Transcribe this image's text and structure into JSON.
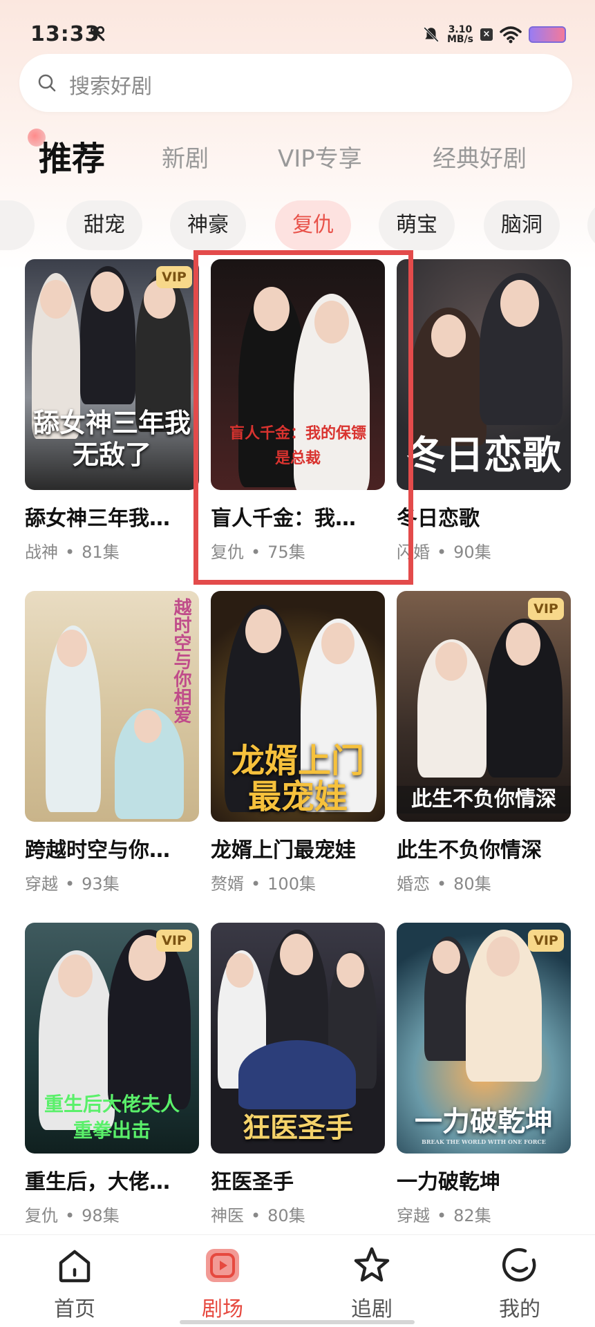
{
  "status_bar": {
    "time": "13:33",
    "net_speed_value": "3.10",
    "net_speed_unit": "MB/s",
    "icons": [
      "tools-icon",
      "mute-icon",
      "close-box-icon",
      "wifi-icon",
      "battery-icon"
    ]
  },
  "search": {
    "placeholder": "搜索好剧"
  },
  "tabs": [
    {
      "label": "推荐",
      "active": true
    },
    {
      "label": "新剧",
      "active": false
    },
    {
      "label": "VIP专享",
      "active": false
    },
    {
      "label": "经典好剧",
      "active": false
    }
  ],
  "chips": [
    {
      "label": "甜宠",
      "active": false
    },
    {
      "label": "神豪",
      "active": false
    },
    {
      "label": "复仇",
      "active": true
    },
    {
      "label": "萌宝",
      "active": false
    },
    {
      "label": "脑洞",
      "active": false
    }
  ],
  "dramas": [
    {
      "title": "舔女神三年我…",
      "genre": "战神",
      "episodes": "81集",
      "vip": true,
      "poster_text": "舔女神三年我无敌了",
      "colors": [
        "#3b3f4a",
        "#8b8f96"
      ]
    },
    {
      "title": "盲人千金：我…",
      "genre": "复仇",
      "episodes": "75集",
      "vip": false,
      "poster_text": "盲人千金：我的保镖是总裁",
      "colors": [
        "#1a1414",
        "#4a2222"
      ]
    },
    {
      "title": "冬日恋歌",
      "genre": "闪婚",
      "episodes": "90集",
      "vip": false,
      "poster_text": "冬日恋歌",
      "colors": [
        "#2b2b2f",
        "#5a4f4f"
      ]
    },
    {
      "title": "跨越时空与你…",
      "genre": "穿越",
      "episodes": "93集",
      "vip": false,
      "poster_text": "越时空与你相爱",
      "colors": [
        "#e9dcc2",
        "#c9b48a"
      ]
    },
    {
      "title": "龙婿上门最宠娃",
      "genre": "赘婿",
      "episodes": "100集",
      "vip": false,
      "poster_text": "龙婿上门最宠娃",
      "colors": [
        "#2a1d12",
        "#6a4a20"
      ]
    },
    {
      "title": "此生不负你情深",
      "genre": "婚恋",
      "episodes": "80集",
      "vip": true,
      "poster_text": "此生不负你情深",
      "colors": [
        "#3a2e28",
        "#7a5e4a"
      ]
    },
    {
      "title": "重生后，大佬…",
      "genre": "复仇",
      "episodes": "98集",
      "vip": true,
      "poster_text": "重生后大佬夫人重拳出击",
      "colors": [
        "#1f3a3c",
        "#3f5a5e"
      ]
    },
    {
      "title": "狂医圣手",
      "genre": "神医",
      "episodes": "80集",
      "vip": false,
      "poster_text": "狂医圣手",
      "colors": [
        "#1d1c22",
        "#3a3945"
      ]
    },
    {
      "title": "一力破乾坤",
      "genre": "穿越",
      "episodes": "82集",
      "vip": true,
      "poster_text": "一力破乾坤",
      "poster_subtext": "BREAK THE WORLD WITH ONE FORCE",
      "colors": [
        "#1d3a4a",
        "#6a9aa8"
      ]
    }
  ],
  "bottom_nav": [
    {
      "label": "首页",
      "icon": "home-icon",
      "active": false
    },
    {
      "label": "剧场",
      "icon": "theater-play-icon",
      "active": true
    },
    {
      "label": "追剧",
      "icon": "star-icon",
      "active": false
    },
    {
      "label": "我的",
      "icon": "smile-profile-icon",
      "active": false
    }
  ],
  "vip_badge_label": "VIP",
  "meta_separator": "•",
  "colors": {
    "accent": "#e6493f",
    "highlight_border": "#e34b4b",
    "vip_badge": "#f7d88a"
  }
}
